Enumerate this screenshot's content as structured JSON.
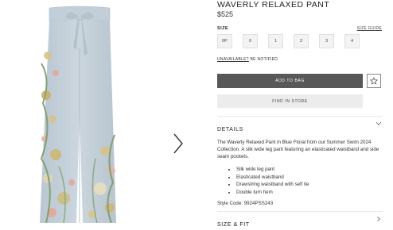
{
  "product": {
    "title": "WAVERLY RELAXED PANT",
    "price": "$525"
  },
  "size": {
    "label": "SIZE",
    "guide_label": "SIZE GUIDE",
    "options": [
      "0P",
      "0",
      "1",
      "2",
      "3",
      "4"
    ],
    "unavailable_label": "UNAVAILABLE?",
    "notify_label": "BE NOTIFIED"
  },
  "actions": {
    "add_to_bag": "ADD TO BAG",
    "find_in_store": "FIND IN STORE"
  },
  "details": {
    "heading": "DETAILS",
    "description": "The Waverly Relaxed Pant in Blue Floral from our Summer Swim 2024 Collection. A silk wide leg pant featuring an elasticated waistband and side seam pockets.",
    "bullets": [
      "Silk wide leg pant",
      "Elasticated waistband",
      "Drawstring waistband with self tie",
      "Double turn hem"
    ],
    "style_code": "Style Code: 9924PSS243"
  },
  "size_fit": {
    "heading": "SIZE & FIT"
  },
  "icons": {
    "next": "chevron-right-icon",
    "wishlist": "star-icon",
    "expand": "chevron-down-icon",
    "size_fit_expand": "chevron-right-icon"
  },
  "colors": {
    "add_to_bag_bg": "#585858",
    "find_in_store_bg": "#ececec",
    "fabric": "#c7d3dc"
  }
}
